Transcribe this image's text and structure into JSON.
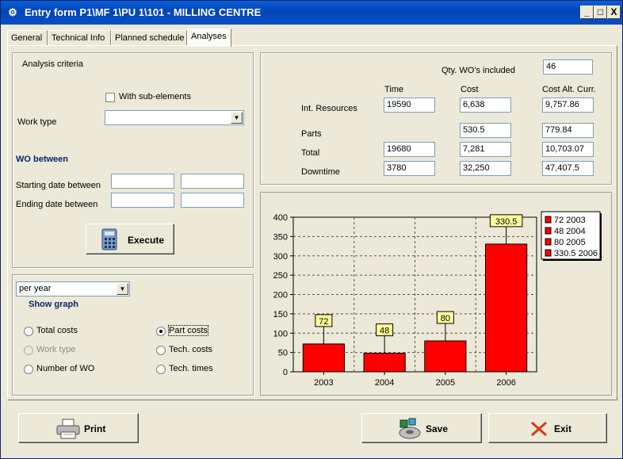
{
  "window": {
    "title": "Entry form P1\\MF 1\\PU 1\\101 - MILLING CENTRE",
    "min_label": "_",
    "max_label": "□",
    "close_label": "X"
  },
  "tabs": [
    {
      "label": "General"
    },
    {
      "label": "Technical Info"
    },
    {
      "label": "Planned schedule"
    },
    {
      "label": "Analyses"
    }
  ],
  "criteria": {
    "heading": "Analysis criteria",
    "with_sub_elements": "With sub-elements",
    "work_type_label": "Work type",
    "work_type_value": "",
    "wo_between": "WO between",
    "starting_date_label": "Starting date between",
    "ending_date_label": "Ending date between",
    "start_from": "",
    "start_to": "",
    "end_from": "",
    "end_to": "",
    "execute_label": "Execute"
  },
  "graph_opts": {
    "period_value": "per year",
    "show_graph": "Show graph",
    "options": {
      "total_costs": "Total costs",
      "part_costs": "Part costs",
      "work_type": "Work type",
      "tech_costs": "Tech. costs",
      "number_of_wo": "Number of WO",
      "tech_times": "Tech. times"
    },
    "selected": "part_costs"
  },
  "summary": {
    "qty_label": "Qty. WO's included",
    "qty_value": "46",
    "col_time": "Time",
    "col_cost": "Cost",
    "col_alt": "Cost Alt. Curr.",
    "rows": {
      "int_resources": {
        "label": "Int. Resources",
        "time": "19590",
        "cost": "6,638",
        "alt": "9,757.86"
      },
      "parts": {
        "label": "Parts",
        "time": "",
        "cost": "530.5",
        "alt": "779.84"
      },
      "total": {
        "label": "Total",
        "time": "19680",
        "cost": "7,281",
        "alt": "10,703.07"
      },
      "downtime": {
        "label": "Downtime",
        "time": "3780",
        "cost": "32,250",
        "alt": "47,407.5"
      }
    }
  },
  "chart_data": {
    "type": "bar",
    "categories": [
      "2003",
      "2004",
      "2005",
      "2006"
    ],
    "values": [
      72,
      48,
      80,
      330.5
    ],
    "data_labels": [
      "72",
      "48",
      "80",
      "330.5"
    ],
    "legend": [
      "72 2003",
      "48 2004",
      "80 2005",
      "330.5 2006"
    ],
    "ylim": [
      0,
      400
    ],
    "yticks": [
      "0",
      "50",
      "100",
      "150",
      "200",
      "250",
      "300",
      "350",
      "400"
    ],
    "grid": true,
    "legend_position": "right",
    "bar_color": "#ff0000"
  },
  "footer": {
    "print_label": "Print",
    "save_label": "Save",
    "exit_label": "Exit"
  }
}
